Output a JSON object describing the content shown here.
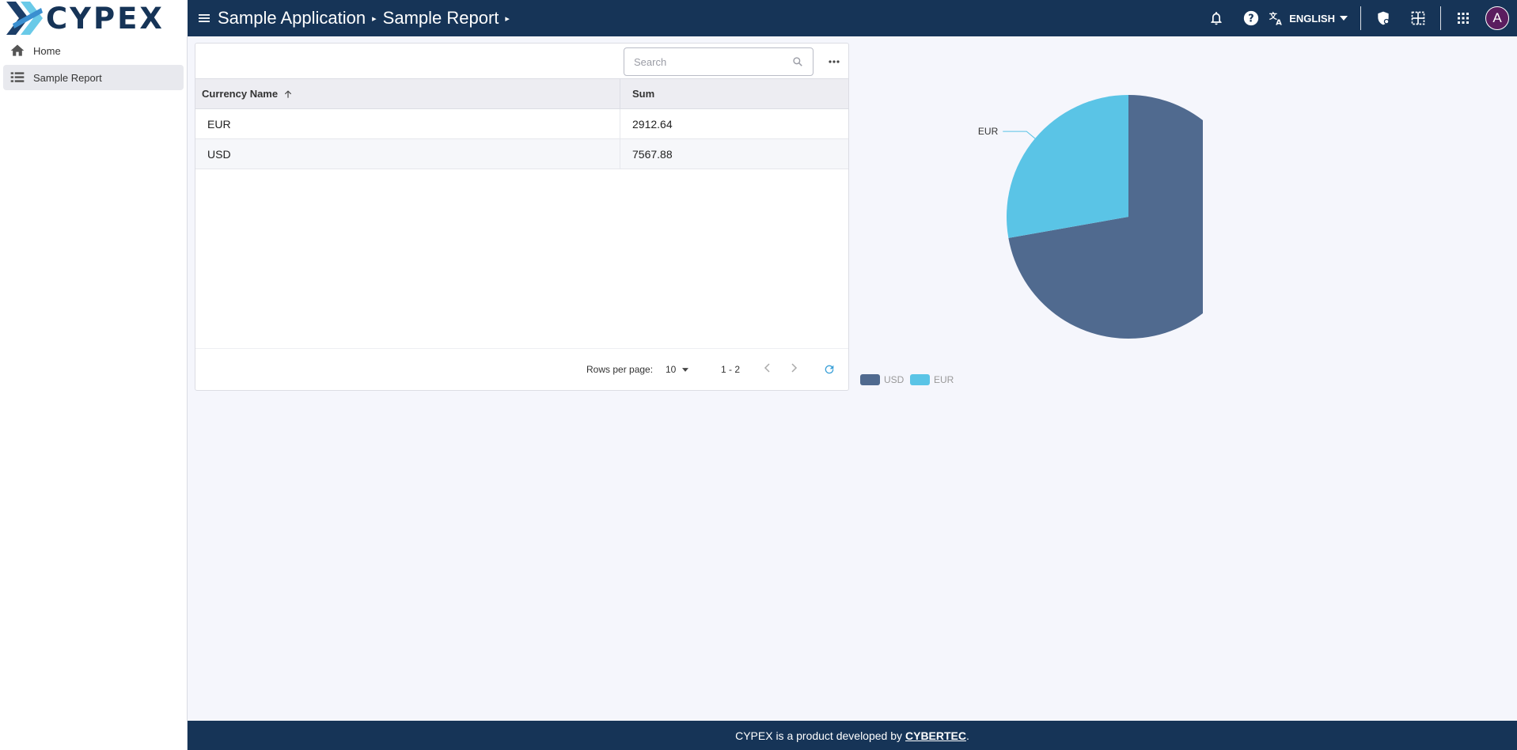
{
  "header": {
    "logo_text": "CYPEX",
    "breadcrumbs": [
      "Sample Application",
      "Sample Report"
    ],
    "language": "ENGLISH",
    "avatar_initial": "A"
  },
  "sidebar": {
    "items": [
      {
        "label": "Home",
        "icon": "home-icon",
        "active": false
      },
      {
        "label": "Sample Report",
        "icon": "table-list-icon",
        "active": true
      }
    ]
  },
  "table": {
    "search_placeholder": "Search",
    "columns": [
      "Currency Name",
      "Sum"
    ],
    "sort_column": "Currency Name",
    "sort_direction": "ascending",
    "rows": [
      {
        "currency": "EUR",
        "sum": "2912.64"
      },
      {
        "currency": "USD",
        "sum": "7567.88"
      }
    ],
    "rows_per_page_label": "Rows per page:",
    "rows_per_page_value": "10",
    "range_text": "1 - 2"
  },
  "chart_data": {
    "type": "pie",
    "slices": [
      {
        "name": "USD",
        "value": 7567.88,
        "color": "#506a8f"
      },
      {
        "name": "EUR",
        "value": 2912.64,
        "color": "#5ac4e6"
      }
    ],
    "legend": [
      "USD",
      "EUR"
    ],
    "legend_position": "bottom-left"
  },
  "footer": {
    "text_prefix": "CYPEX is a product developed by",
    "link": "CYBERTEC",
    "suffix": "."
  },
  "colors": {
    "header_bg": "#163457",
    "usd": "#506a8f",
    "eur": "#5ac4e6",
    "refresh": "#3aa0d8",
    "avatar": "#5b1d5f"
  }
}
